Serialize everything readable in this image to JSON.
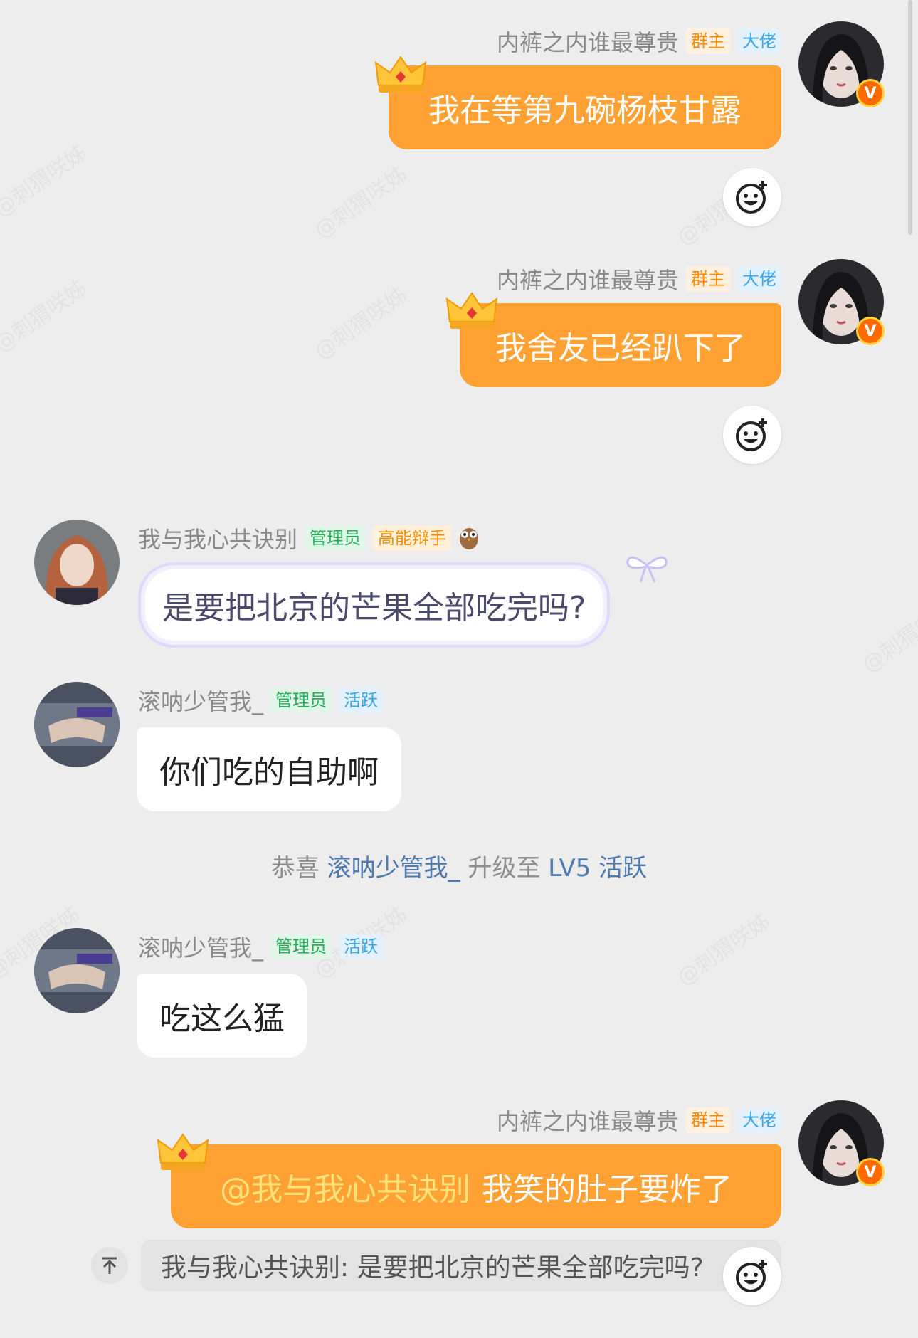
{
  "watermark": "@刺猬咲姊",
  "messages": [
    {
      "sender": "内裤之内谁最尊贵",
      "tags": [
        "群主",
        "大佬"
      ],
      "text": "我在等第九碗杨枝甘露"
    },
    {
      "sender": "内裤之内谁最尊贵",
      "tags": [
        "群主",
        "大佬"
      ],
      "text": "我舍友已经趴下了"
    },
    {
      "sender": "我与我心共诀别",
      "tags": [
        "管理员",
        "高能辩手"
      ],
      "text": "是要把北京的芒果全部吃完吗?"
    },
    {
      "sender": "滚呐少管我_",
      "tags": [
        "管理员",
        "活跃"
      ],
      "text": "你们吃的自助啊"
    },
    {
      "sender": "滚呐少管我_",
      "tags": [
        "管理员",
        "活跃"
      ],
      "text": "吃这么猛"
    },
    {
      "sender": "内裤之内谁最尊贵",
      "tags": [
        "群主",
        "大佬"
      ],
      "mention": "@我与我心共诀别",
      "text": "我笑的肚子要炸了"
    }
  ],
  "system": {
    "prefix": "恭喜",
    "user": "滚呐少管我_",
    "middle": "升级至",
    "level": "LV5 活跃"
  },
  "quote": {
    "text": "我与我心共诀别: 是要把北京的芒果全部吃完吗?"
  },
  "colors": {
    "out_bubble": "#ffa233",
    "background": "#ededed",
    "owner_tag": "#ff8a00",
    "admin_tag": "#27b05a"
  },
  "icons": [
    "crown-icon",
    "emoji-reaction-icon",
    "verified-v-icon",
    "owl-icon",
    "bow-icon",
    "scroll-top-icon"
  ]
}
